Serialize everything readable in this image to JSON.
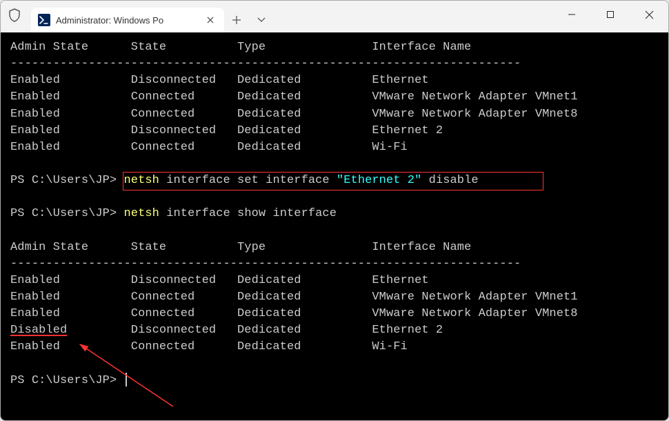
{
  "window": {
    "tab_title": "Administrator: Windows Po",
    "ps_glyph": ">_"
  },
  "table1": {
    "header": {
      "c1": "Admin State",
      "c2": "State",
      "c3": "Type",
      "c4": "Interface Name"
    },
    "separator": "------------------------------------------------------------------------",
    "rows": [
      {
        "c1": "Enabled",
        "c2": "Disconnected",
        "c3": "Dedicated",
        "c4": "Ethernet"
      },
      {
        "c1": "Enabled",
        "c2": "Connected",
        "c3": "Dedicated",
        "c4": "VMware Network Adapter VMnet1"
      },
      {
        "c1": "Enabled",
        "c2": "Connected",
        "c3": "Dedicated",
        "c4": "VMware Network Adapter VMnet8"
      },
      {
        "c1": "Enabled",
        "c2": "Disconnected",
        "c3": "Dedicated",
        "c4": "Ethernet 2"
      },
      {
        "c1": "Enabled",
        "c2": "Connected",
        "c3": "Dedicated",
        "c4": "Wi-Fi"
      }
    ]
  },
  "cmd1": {
    "prompt": "PS C:\\Users\\JP> ",
    "keyword": "netsh",
    "rest1": " interface set interface ",
    "arg": "\"Ethernet 2\"",
    "rest2": " disable"
  },
  "cmd2": {
    "prompt": "PS C:\\Users\\JP> ",
    "keyword": "netsh",
    "rest": " interface show interface"
  },
  "table2": {
    "header": {
      "c1": "Admin State",
      "c2": "State",
      "c3": "Type",
      "c4": "Interface Name"
    },
    "separator": "------------------------------------------------------------------------",
    "rows": [
      {
        "c1": "Enabled",
        "c2": "Disconnected",
        "c3": "Dedicated",
        "c4": "Ethernet"
      },
      {
        "c1": "Enabled",
        "c2": "Connected",
        "c3": "Dedicated",
        "c4": "VMware Network Adapter VMnet1"
      },
      {
        "c1": "Enabled",
        "c2": "Connected",
        "c3": "Dedicated",
        "c4": "VMware Network Adapter VMnet8"
      },
      {
        "c1": "Disabled",
        "c2": "Disconnected",
        "c3": "Dedicated",
        "c4": "Ethernet 2"
      },
      {
        "c1": "Enabled",
        "c2": "Connected",
        "c3": "Dedicated",
        "c4": "Wi-Fi"
      }
    ]
  },
  "prompt3": "PS C:\\Users\\JP> "
}
